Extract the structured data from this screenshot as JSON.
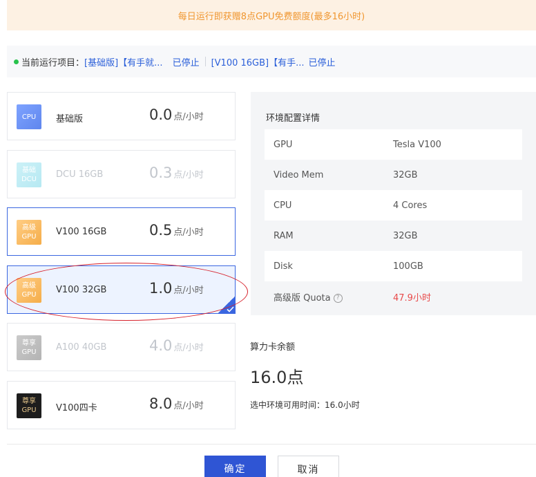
{
  "banner": {
    "text": "每日运行即获赠8点GPU免费额度(最多16小时)"
  },
  "running": {
    "label": "当前运行项目：",
    "items": [
      {
        "name": "[基础版]【有手就...",
        "status": "已停止"
      },
      {
        "name": "[V100 16GB]【有手...",
        "status": "已停止"
      }
    ]
  },
  "cards": [
    {
      "badge": [
        "CPU"
      ],
      "name": "基础版",
      "price": "0.0",
      "unit": "点/小时"
    },
    {
      "badge": [
        "基础",
        "DCU"
      ],
      "name": "DCU 16GB",
      "price": "0.3",
      "unit": "点/小时"
    },
    {
      "badge": [
        "高级",
        "GPU"
      ],
      "name": "V100 16GB",
      "price": "0.5",
      "unit": "点/小时"
    },
    {
      "badge": [
        "高级",
        "GPU"
      ],
      "name": "V100 32GB",
      "price": "1.0",
      "unit": "点/小时"
    },
    {
      "badge": [
        "尊享",
        "GPU"
      ],
      "name": "A100 40GB",
      "price": "4.0",
      "unit": "点/小时"
    },
    {
      "badge": [
        "尊享",
        "GPU"
      ],
      "name": "V100四卡",
      "price": "8.0",
      "unit": "点/小时"
    }
  ],
  "env": {
    "title": "环境配置详情",
    "rows": [
      {
        "key": "GPU",
        "value": "Tesla V100"
      },
      {
        "key": "Video Mem",
        "value": "32GB"
      },
      {
        "key": "CPU",
        "value": "4 Cores"
      },
      {
        "key": "RAM",
        "value": "32GB"
      },
      {
        "key": "Disk",
        "value": "100GB"
      },
      {
        "key": "高级版 Quota",
        "value": "47.9小时"
      }
    ],
    "help_glyph": "?"
  },
  "balance": {
    "label": "算力卡余额",
    "value": "16.0点",
    "available": "选中环境可用时间：16.0小时"
  },
  "buttons": {
    "ok": "确定",
    "cancel": "取消"
  },
  "colors": {
    "accent": "#2f55d4",
    "banner_text": "#f0962f",
    "quota": "#e84a4a",
    "annotation": "#d6202a"
  }
}
